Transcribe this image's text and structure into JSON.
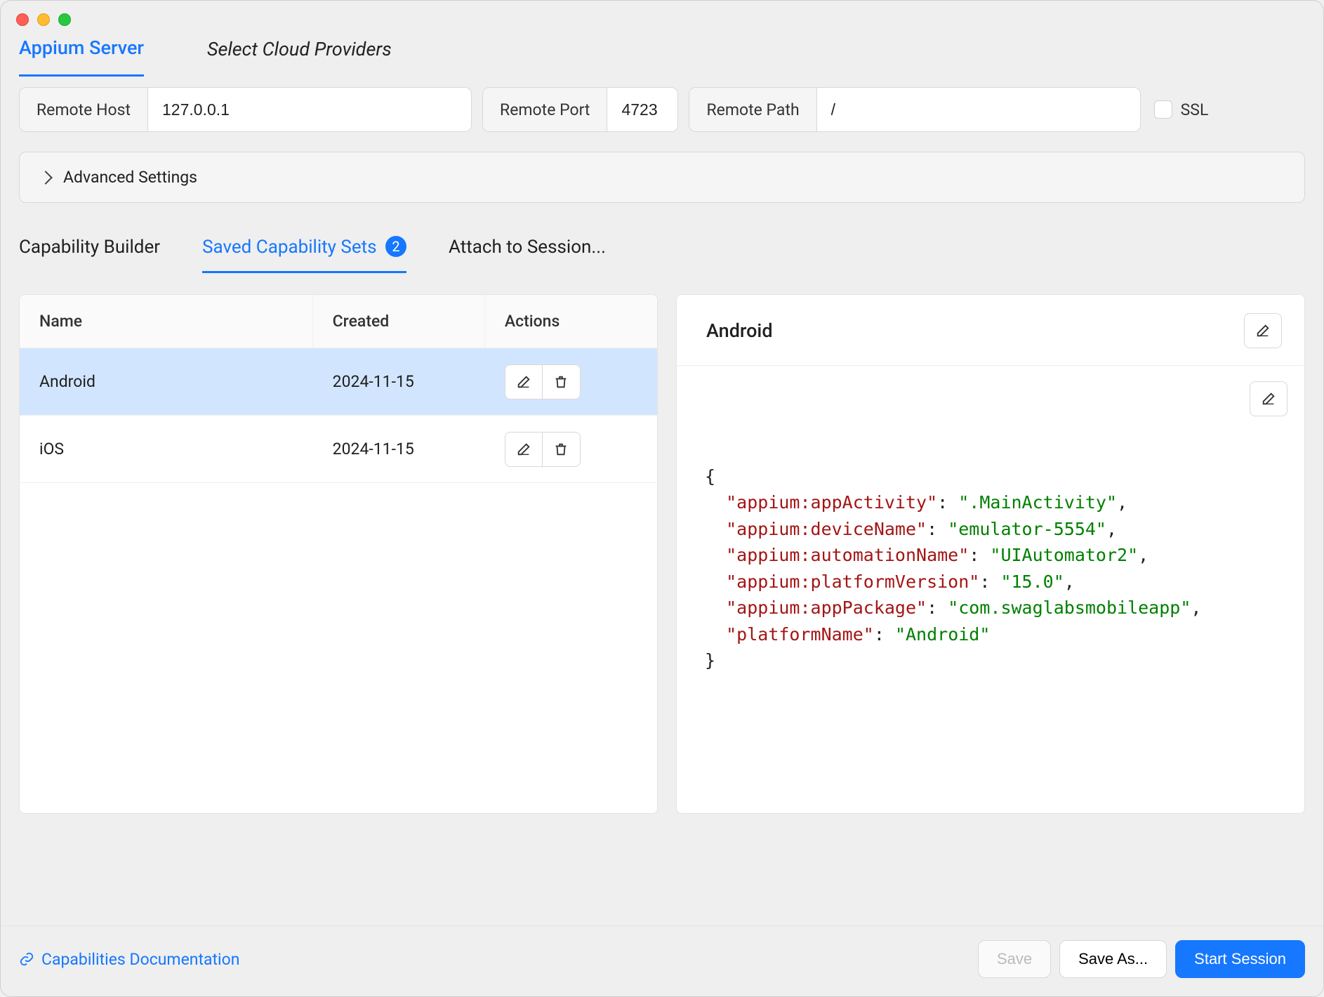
{
  "topTabs": {
    "appiumServer": "Appium Server",
    "selectCloud": "Select Cloud Providers"
  },
  "conn": {
    "remoteHostLabel": "Remote Host",
    "remoteHost": "127.0.0.1",
    "remotePortLabel": "Remote Port",
    "remotePort": "4723",
    "remotePathLabel": "Remote Path",
    "remotePath": "/",
    "sslLabel": "SSL"
  },
  "advanced": {
    "label": "Advanced Settings"
  },
  "capTabs": {
    "builder": "Capability Builder",
    "saved": "Saved Capability Sets",
    "savedCount": "2",
    "attach": "Attach to Session..."
  },
  "table": {
    "headers": {
      "name": "Name",
      "created": "Created",
      "actions": "Actions"
    },
    "rows": [
      {
        "name": "Android",
        "created": "2024-11-15",
        "selected": true
      },
      {
        "name": "iOS",
        "created": "2024-11-15",
        "selected": false
      }
    ]
  },
  "detail": {
    "title": "Android",
    "caps": {
      "appium:appActivity": ".MainActivity",
      "appium:deviceName": "emulator-5554",
      "appium:automationName": "UIAutomator2",
      "appium:platformVersion": "15.0",
      "appium:appPackage": "com.swaglabsmobileapp",
      "platformName": "Android"
    }
  },
  "footer": {
    "docLink": "Capabilities Documentation",
    "save": "Save",
    "saveAs": "Save As...",
    "start": "Start Session"
  }
}
